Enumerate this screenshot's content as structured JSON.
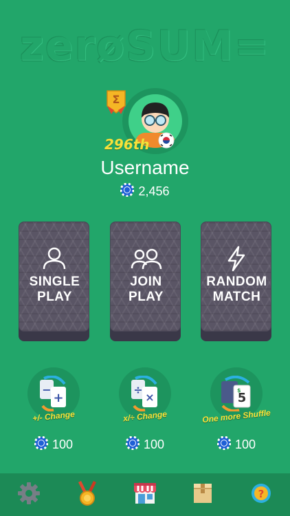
{
  "app": {
    "logo_text": "zerøSUM="
  },
  "profile": {
    "rank": "296th",
    "username": "Username",
    "coins": "2,456",
    "flag_icon": "korea-flag-icon",
    "trophy_icon": "sigma-trophy-icon"
  },
  "modes": [
    {
      "line1": "SINGLE",
      "line2": "PLAY",
      "icon": "single-user-icon"
    },
    {
      "line1": "JOIN",
      "line2": "PLAY",
      "icon": "two-users-icon"
    },
    {
      "line1": "RANDOM",
      "line2": "MATCH",
      "icon": "lightning-icon"
    }
  ],
  "powerups": [
    {
      "label": "+/- Change",
      "cost": "100",
      "icon": "plus-minus-change-icon"
    },
    {
      "label": "x/÷ Change",
      "cost": "100",
      "icon": "times-divide-change-icon"
    },
    {
      "label": "One more Shuffle",
      "cost": "100",
      "icon": "shuffle-icon"
    }
  ],
  "nav": [
    {
      "icon": "gear-icon"
    },
    {
      "icon": "medal-icon"
    },
    {
      "icon": "shop-icon"
    },
    {
      "icon": "box-icon"
    },
    {
      "icon": "help-icon"
    }
  ],
  "colors": {
    "background": "#22a66a",
    "accent_yellow": "#f7e13a",
    "card": "#5a5565",
    "nav": "#1c8a56"
  }
}
